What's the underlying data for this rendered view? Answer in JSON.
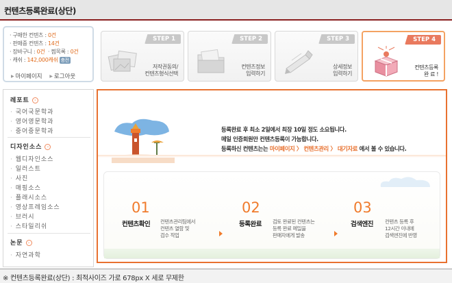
{
  "page_title": "컨텐츠등록완료(상단)",
  "user_box": {
    "purchased_label": "구매한 컨텐츠 :",
    "purchased_value": "0건",
    "selling_label": "판매중 컨텐츠 :",
    "selling_value": "14건",
    "cart_label": "장바구니 :",
    "cart_value": "0건",
    "wish_label": "찜목록 :",
    "wish_value": "0건",
    "cash_label": "캐쉬 :",
    "cash_value": "142,000캐쉬",
    "cash_button": "충전",
    "link_mypage": "마이페이지",
    "link_logout": "로그아웃"
  },
  "steps": [
    {
      "badge": "STEP 1",
      "line1": "저작권동의/",
      "line2": "컨텐츠형식선택",
      "active": false,
      "icon": "photos-icon"
    },
    {
      "badge": "STEP 2",
      "line1": "컨텐츠정보",
      "line2": "입력하기",
      "active": false,
      "icon": "folder-icon"
    },
    {
      "badge": "STEP 3",
      "line1": "상세정보",
      "line2": "입력하기",
      "active": false,
      "icon": "pen-icon"
    },
    {
      "badge": "STEP 4",
      "line1": "컨텐츠등록",
      "line2": "완 료 !",
      "active": true,
      "icon": "gift-box-icon"
    }
  ],
  "left_nav": {
    "section_report": "레포트",
    "report_items": [
      "국어국문학과",
      "영어영문학과",
      "중어중문학과"
    ],
    "section_design": "디자인소스",
    "design_items": [
      "웹디자인소스",
      "일러스트",
      "사진",
      "매핑소스",
      "플래시소스",
      "영상프레임소스",
      "브러시",
      "스타일리쉬"
    ],
    "section_thesis": "논문",
    "thesis_items": [
      "자연과학"
    ]
  },
  "notice": {
    "line1": "등록완료 후 최소 2일에서 최장 10일 정도 소요됩니다.",
    "line2": "메일 인증회원만 컨텐츠등록이 가능합니다.",
    "line3_prefix": "등록하신 컨텐츠는는",
    "line3_path": "마이페이지 〉 컨텐츠관리 〉 대기자료",
    "line3_suffix": "에서 볼 수 있습니다."
  },
  "process": [
    {
      "num": "01",
      "title": "컨텐츠확인",
      "desc1": "컨텐츠관리팀에서",
      "desc2": "컨텐츠 열람 및",
      "desc3": "검수 작업"
    },
    {
      "num": "02",
      "title": "등록완료",
      "desc1": "검토 완료된 컨텐츠는",
      "desc2": "등록 완료 메일을",
      "desc3": "판매자에게 발송"
    },
    {
      "num": "03",
      "title": "검색엔진",
      "desc1": "컨텐츠 등록 후",
      "desc2": "12시간 이내에",
      "desc3": "검색엔진에 반영"
    }
  ],
  "footer": "※ 컨텐츠등록완료(상단) : 최적사이즈 가로 678px  X 세로 무제한",
  "colors": {
    "accent": "#e8712f",
    "title_border": "#8a1f1f",
    "step_active": "#e97a5e"
  }
}
